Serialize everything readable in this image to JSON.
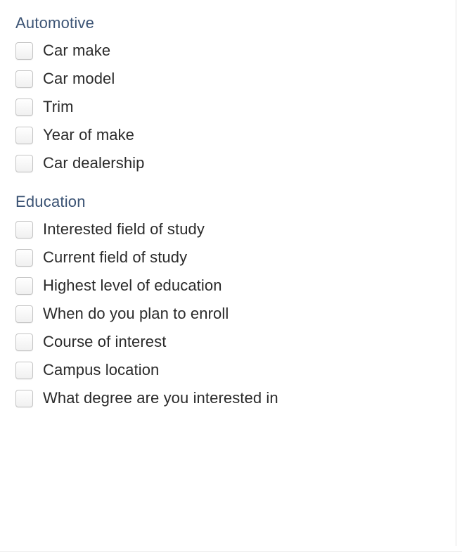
{
  "sections": [
    {
      "title": "Automotive",
      "name": "automotive-section",
      "items": [
        {
          "label": "Car make",
          "name": "checkbox-car-make"
        },
        {
          "label": "Car model",
          "name": "checkbox-car-model"
        },
        {
          "label": "Trim",
          "name": "checkbox-trim"
        },
        {
          "label": "Year of make",
          "name": "checkbox-year-of-make"
        },
        {
          "label": "Car dealership",
          "name": "checkbox-car-dealership"
        }
      ]
    },
    {
      "title": "Education",
      "name": "education-section",
      "items": [
        {
          "label": "Interested field of study",
          "name": "checkbox-interested-field-of-study"
        },
        {
          "label": "Current field of study",
          "name": "checkbox-current-field-of-study"
        },
        {
          "label": "Highest level of education",
          "name": "checkbox-highest-level-of-education"
        },
        {
          "label": "When do you plan to enroll",
          "name": "checkbox-when-do-you-plan-to-enroll"
        },
        {
          "label": "Course of interest",
          "name": "checkbox-course-of-interest"
        },
        {
          "label": "Campus location",
          "name": "checkbox-campus-location"
        },
        {
          "label": "What degree are you interested in",
          "name": "checkbox-what-degree-are-you-interested-in"
        }
      ]
    }
  ]
}
